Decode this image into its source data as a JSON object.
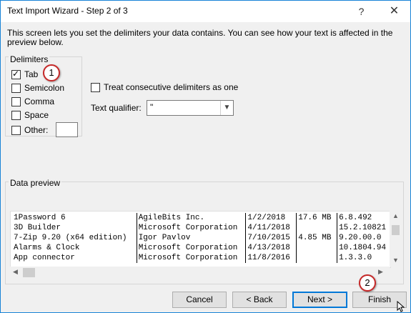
{
  "window": {
    "title": "Text Import Wizard - Step 2 of 3",
    "help_glyph": "?",
    "close_glyph": "✕"
  },
  "description": "This screen lets you set the delimiters your data contains.  You can see how your text is affected in the preview below.",
  "delimiters": {
    "label": "Delimiters",
    "options": [
      {
        "label": "Tab",
        "checked": true
      },
      {
        "label": "Semicolon",
        "checked": false
      },
      {
        "label": "Comma",
        "checked": false
      },
      {
        "label": "Space",
        "checked": false
      },
      {
        "label": "Other:",
        "checked": false
      }
    ],
    "other_value": ""
  },
  "treat_consecutive": {
    "label": "Treat consecutive delimiters as one",
    "checked": false
  },
  "text_qualifier": {
    "label": "Text qualifier:",
    "value": "\""
  },
  "preview": {
    "label": "Data preview",
    "rows": [
      [
        "1Password 6",
        "AgileBits Inc.",
        "1/2/2018",
        "17.6 MB",
        "6.8.492"
      ],
      [
        "3D Builder",
        "Microsoft Corporation",
        "4/11/2018",
        "",
        "15.2.10821"
      ],
      [
        "7-Zip 9.20 (x64 edition)",
        "Igor Pavlov",
        "7/10/2015",
        "4.85 MB",
        "9.20.00.0"
      ],
      [
        "Alarms & Clock",
        "Microsoft Corporation",
        "4/13/2018",
        "",
        "10.1804.94"
      ],
      [
        "App connector",
        "Microsoft Corporation",
        "11/8/2016",
        "",
        "1.3.3.0"
      ]
    ]
  },
  "buttons": {
    "cancel": "Cancel",
    "back": "< Back",
    "next": "Next >",
    "finish": "Finish"
  },
  "annotations": {
    "step1": "1",
    "step2": "2"
  },
  "colors": {
    "accent": "#0078d7",
    "badge_ring": "#c62828"
  }
}
